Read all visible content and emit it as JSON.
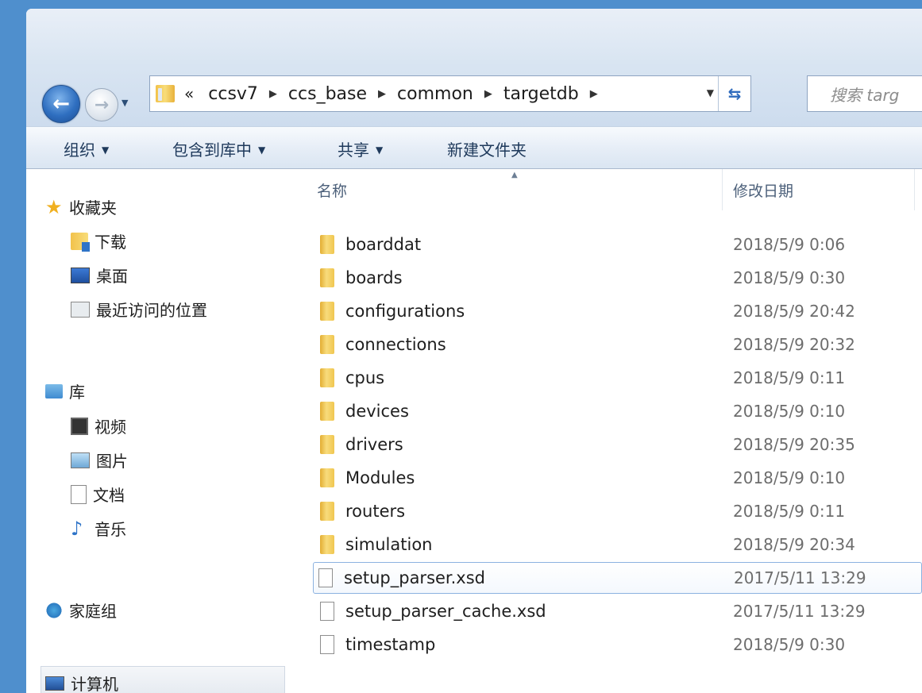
{
  "address": {
    "overflow": "«",
    "crumbs": [
      "ccsv7",
      "ccs_base",
      "common",
      "targetdb"
    ],
    "search_placeholder": "搜索 targ"
  },
  "toolbar": {
    "organize": "组织",
    "include_library": "包含到库中",
    "share": "共享",
    "new_folder": "新建文件夹"
  },
  "nav": {
    "favorites": "收藏夹",
    "downloads": "下载",
    "desktop": "桌面",
    "recent": "最近访问的位置",
    "libraries": "库",
    "videos": "视频",
    "pictures": "图片",
    "documents": "文档",
    "music": "音乐",
    "homegroup": "家庭组",
    "computer": "计算机"
  },
  "columns": {
    "name": "名称",
    "modified": "修改日期"
  },
  "files": [
    {
      "name": "boarddat",
      "date": "2018/5/9 0:06",
      "type": "folder"
    },
    {
      "name": "boards",
      "date": "2018/5/9 0:30",
      "type": "folder"
    },
    {
      "name": "configurations",
      "date": "2018/5/9 20:42",
      "type": "folder"
    },
    {
      "name": "connections",
      "date": "2018/5/9 20:32",
      "type": "folder"
    },
    {
      "name": "cpus",
      "date": "2018/5/9 0:11",
      "type": "folder"
    },
    {
      "name": "devices",
      "date": "2018/5/9 0:10",
      "type": "folder"
    },
    {
      "name": "drivers",
      "date": "2018/5/9 20:35",
      "type": "folder"
    },
    {
      "name": "Modules",
      "date": "2018/5/9 0:10",
      "type": "folder"
    },
    {
      "name": "routers",
      "date": "2018/5/9 0:11",
      "type": "folder"
    },
    {
      "name": "simulation",
      "date": "2018/5/9 20:34",
      "type": "folder"
    },
    {
      "name": "setup_parser.xsd",
      "date": "2017/5/11 13:29",
      "type": "file",
      "selected": true
    },
    {
      "name": "setup_parser_cache.xsd",
      "date": "2017/5/11 13:29",
      "type": "file"
    },
    {
      "name": "timestamp",
      "date": "2018/5/9 0:30",
      "type": "file"
    }
  ],
  "colors": {
    "frame": "#4f8fcd",
    "toolbar_text": "#1e395b",
    "selection_border": "#8bb2e0",
    "folder": "#f2c24b"
  }
}
